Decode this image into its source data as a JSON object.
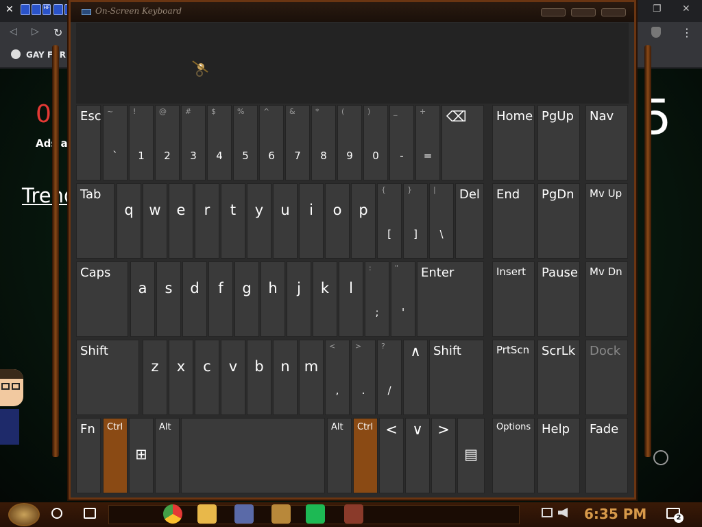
{
  "browser": {
    "tab_close": "✕",
    "ext_badge": "HF",
    "window_controls": [
      "—",
      "❐",
      "✕"
    ],
    "nav": [
      "◁",
      "▷",
      "↻"
    ],
    "menu": "⋮",
    "bookmark": "GAY FUR",
    "page_number_left": "0",
    "ads_text": "Ads ar",
    "trend_text": "Trend",
    "page_number_right": "5"
  },
  "osk": {
    "title": "On-Screen Keyboard",
    "rows": [
      [
        {
          "main": "Esc"
        },
        {
          "sym": "~",
          "main": "`"
        },
        {
          "sym": "!",
          "main": "1"
        },
        {
          "sym": "@",
          "main": "2"
        },
        {
          "sym": "#",
          "main": "3"
        },
        {
          "sym": "$",
          "main": "4"
        },
        {
          "sym": "%",
          "main": "5"
        },
        {
          "sym": "^",
          "main": "6"
        },
        {
          "sym": "&",
          "main": "7"
        },
        {
          "sym": "*",
          "main": "8"
        },
        {
          "sym": "(",
          "main": "9"
        },
        {
          "sym": ")",
          "main": "0"
        },
        {
          "sym": "_",
          "main": "-"
        },
        {
          "sym": "+",
          "main": "="
        },
        {
          "main": "⌫"
        }
      ],
      [
        {
          "main": "Tab"
        },
        {
          "main": "q"
        },
        {
          "main": "w"
        },
        {
          "main": "e"
        },
        {
          "main": "r"
        },
        {
          "main": "t"
        },
        {
          "main": "y"
        },
        {
          "main": "u"
        },
        {
          "main": "i"
        },
        {
          "main": "o"
        },
        {
          "main": "p"
        },
        {
          "sym": "{",
          "main": "["
        },
        {
          "sym": "}",
          "main": "]"
        },
        {
          "sym": "|",
          "main": "\\"
        },
        {
          "main": "Del"
        }
      ],
      [
        {
          "main": "Caps"
        },
        {
          "main": "a"
        },
        {
          "main": "s"
        },
        {
          "main": "d"
        },
        {
          "main": "f"
        },
        {
          "main": "g"
        },
        {
          "main": "h"
        },
        {
          "main": "j"
        },
        {
          "main": "k"
        },
        {
          "main": "l"
        },
        {
          "sym": ":",
          "main": ";"
        },
        {
          "sym": "\"",
          "main": "'"
        },
        {
          "main": "Enter"
        }
      ],
      [
        {
          "main": "Shift"
        },
        {
          "main": "z"
        },
        {
          "main": "x"
        },
        {
          "main": "c"
        },
        {
          "main": "v"
        },
        {
          "main": "b"
        },
        {
          "main": "n"
        },
        {
          "main": "m"
        },
        {
          "sym": "<",
          "main": ","
        },
        {
          "sym": ">",
          "main": "."
        },
        {
          "sym": "?",
          "main": "/"
        },
        {
          "main": "∧"
        },
        {
          "main": "Shift"
        }
      ],
      [
        {
          "main": "Fn"
        },
        {
          "main": "Ctrl"
        },
        {
          "main": "⊞"
        },
        {
          "main": "Alt"
        },
        {
          "main": ""
        },
        {
          "main": "Alt"
        },
        {
          "main": "Ctrl"
        },
        {
          "main": "<"
        },
        {
          "main": "∨"
        },
        {
          "main": ">"
        },
        {
          "main": "▤"
        }
      ]
    ],
    "side_keys": [
      [
        "Home",
        "PgUp",
        "Nav"
      ],
      [
        "End",
        "PgDn",
        "Mv Up"
      ],
      [
        "Insert",
        "Pause",
        "Mv Dn"
      ],
      [
        "PrtScn",
        "ScrLk",
        "Dock"
      ],
      [
        "Options",
        "Help",
        "Fade"
      ]
    ]
  },
  "taskbar": {
    "time": "6:35 PM",
    "notification_count": "2"
  },
  "colors": {
    "key_bg": "#3a3a3a",
    "ctrl_key_bg": "#8a4a14",
    "frame_bronze": "#6a3512",
    "clock_amber": "#d89a4a"
  }
}
